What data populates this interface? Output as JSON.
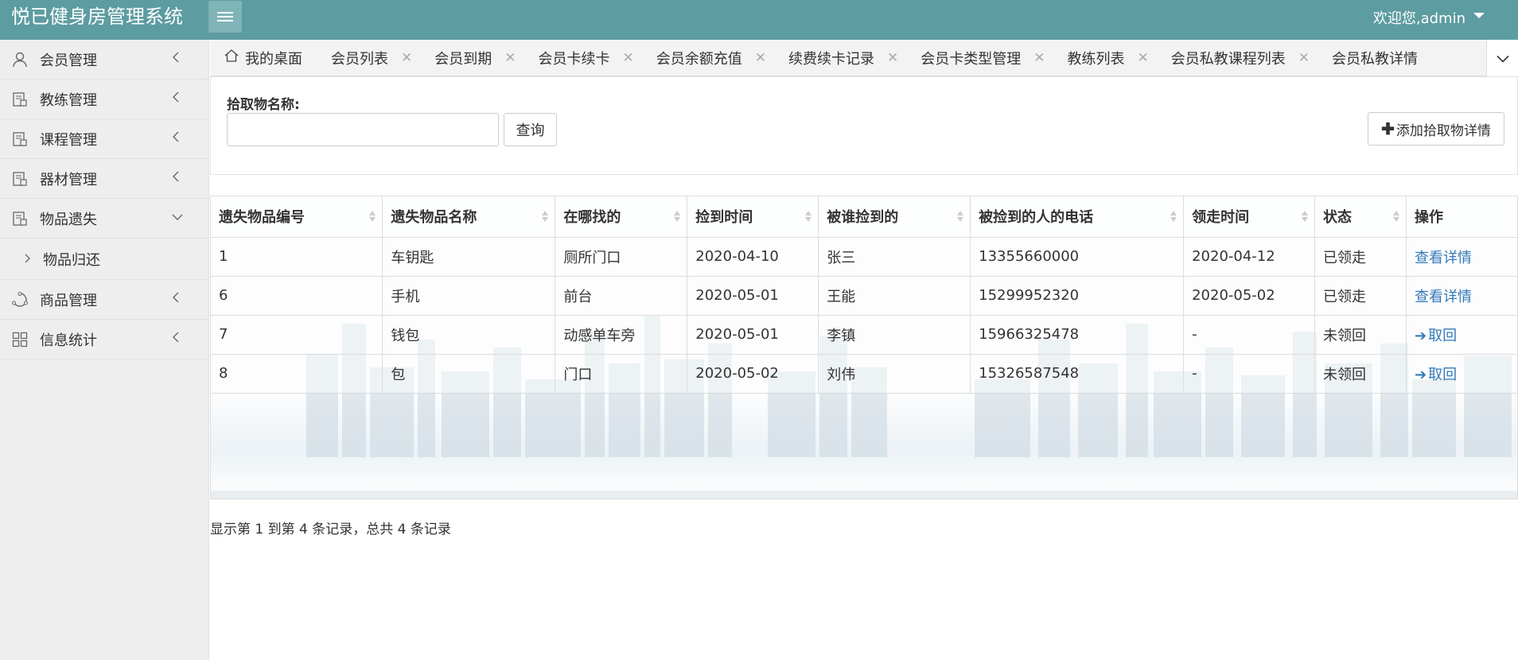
{
  "header": {
    "app_title": "悦已健身房管理系统",
    "user_text": "欢迎您,admin"
  },
  "sidebar": {
    "items": [
      {
        "label": "会员管理",
        "icon": "user-icon"
      },
      {
        "label": "教练管理",
        "icon": "document-icon"
      },
      {
        "label": "课程管理",
        "icon": "document-icon"
      },
      {
        "label": "器材管理",
        "icon": "document-icon"
      },
      {
        "label": "物品遗失",
        "icon": "document-icon",
        "expanded": true
      },
      {
        "label": "商品管理",
        "icon": "cycle-icon"
      },
      {
        "label": "信息统计",
        "icon": "grid-icon"
      }
    ],
    "sub_items": [
      {
        "label": "物品归还"
      }
    ]
  },
  "tabs": [
    {
      "label": "我的桌面"
    },
    {
      "label": "会员列表"
    },
    {
      "label": "会员到期"
    },
    {
      "label": "会员卡续卡"
    },
    {
      "label": "会员余额充值"
    },
    {
      "label": "续费续卡记录"
    },
    {
      "label": "会员卡类型管理"
    },
    {
      "label": "教练列表"
    },
    {
      "label": "会员私教课程列表"
    },
    {
      "label": "会员私教详情"
    }
  ],
  "search": {
    "label": "拾取物名称:",
    "value": "",
    "query_label": "查询",
    "add_label": "添加拾取物详情"
  },
  "table": {
    "columns": [
      "遗失物品编号",
      "遗失物品名称",
      "在哪找的",
      "捡到时间",
      "被谁捡到的",
      "被捡到的人的电话",
      "领走时间",
      "状态",
      "操作"
    ],
    "rows": [
      {
        "id": "1",
        "name": "车钥匙",
        "where": "厕所门口",
        "found_time": "2020-04-10",
        "finder": "张三",
        "phone": "13355660000",
        "taken_time": "2020-04-12",
        "status": "已领走",
        "action": "查看详情",
        "action_type": "detail"
      },
      {
        "id": "6",
        "name": "手机",
        "where": "前台",
        "found_time": "2020-05-01",
        "finder": "王能",
        "phone": "15299952320",
        "taken_time": "2020-05-02",
        "status": "已领走",
        "action": "查看详情",
        "action_type": "detail"
      },
      {
        "id": "7",
        "name": "钱包",
        "where": "动感单车旁",
        "found_time": "2020-05-01",
        "finder": "李镇",
        "phone": "15966325478",
        "taken_time": "-",
        "status": "未领回",
        "action": "取回",
        "action_type": "retrieve"
      },
      {
        "id": "8",
        "name": "包",
        "where": "门口",
        "found_time": "2020-05-02",
        "finder": "刘伟",
        "phone": "15326587548",
        "taken_time": "-",
        "status": "未领回",
        "action": "取回",
        "action_type": "retrieve"
      }
    ]
  },
  "pager": {
    "info": "显示第 1 到第 4 条记录，总共 4 条记录"
  },
  "colors": {
    "header_bg": "#5d9ca1",
    "link": "#337ab7"
  }
}
